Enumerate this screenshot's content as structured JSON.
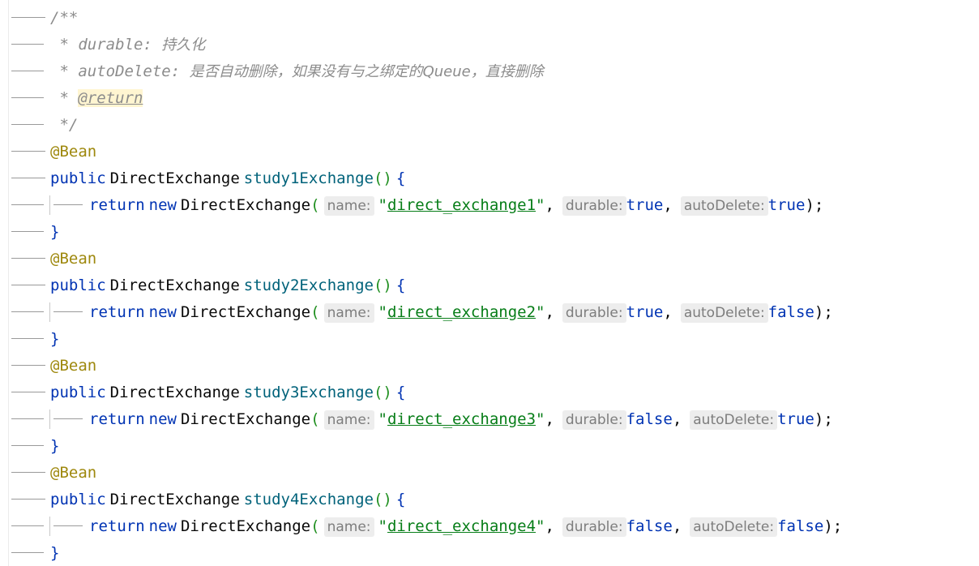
{
  "doc_comment": {
    "open": "/**",
    "durable_prefix": " * durable: ",
    "durable_text": "持久化",
    "autodelete_prefix": " * autoDelete: ",
    "autodelete_text": "是否自动删除，如果没有与之绑定的Queue，直接删除",
    "return_prefix": " * ",
    "return_tag": "@return",
    "close": " */"
  },
  "tokens": {
    "annotation": "@Bean",
    "public": "public",
    "type": "DirectExchange",
    "return": "return",
    "new": "new",
    "paren_open": "(",
    "paren_empty": "()",
    "brace_open": "{",
    "brace_close": "}",
    "close_stmt": ");",
    "comma": ",",
    "quote": "\"",
    "hint_name": "name:",
    "hint_durable": "durable:",
    "hint_autodelete": "autoDelete:"
  },
  "methods": [
    {
      "name": "study1Exchange",
      "exchange": "direct_exchange1",
      "durable": "true",
      "autoDelete": "true"
    },
    {
      "name": "study2Exchange",
      "exchange": "direct_exchange2",
      "durable": "true",
      "autoDelete": "false"
    },
    {
      "name": "study3Exchange",
      "exchange": "direct_exchange3",
      "durable": "false",
      "autoDelete": "true"
    },
    {
      "name": "study4Exchange",
      "exchange": "direct_exchange4",
      "durable": "false",
      "autoDelete": "false"
    }
  ],
  "colors": {
    "keyword": "#0033b3",
    "annotation": "#9e880d",
    "method": "#00627a",
    "string": "#067d17",
    "comment": "#8c8c8c",
    "hint_bg": "#ededed"
  }
}
